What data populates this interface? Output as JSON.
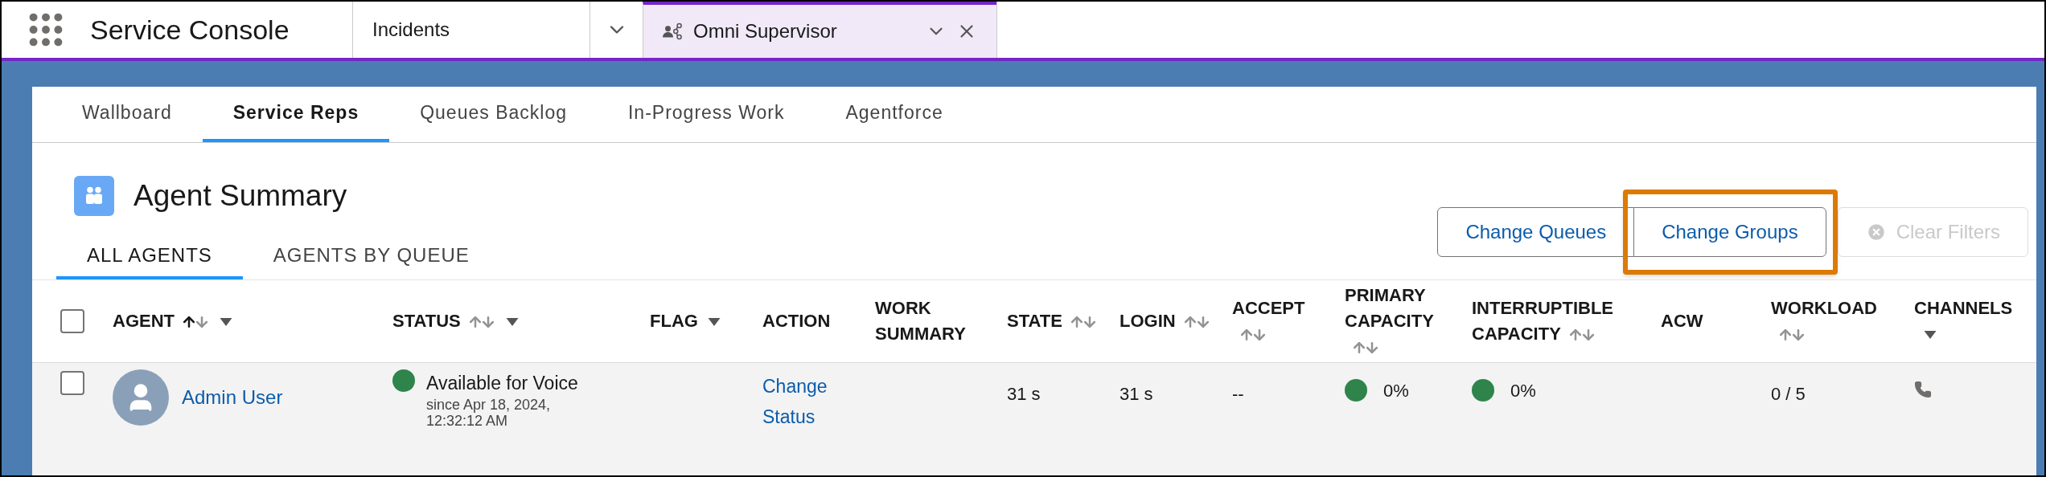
{
  "app": {
    "title": "Service Console"
  },
  "console_tabs": [
    {
      "label": "Incidents",
      "selected": false
    },
    {
      "label": "Omni Supervisor",
      "selected": true
    }
  ],
  "nav_tabs": [
    {
      "label": "Wallboard",
      "selected": false
    },
    {
      "label": "Service Reps",
      "selected": true
    },
    {
      "label": "Queues Backlog",
      "selected": false
    },
    {
      "label": "In-Progress Work",
      "selected": false
    },
    {
      "label": "Agentforce",
      "selected": false
    }
  ],
  "header": {
    "title": "Agent Summary"
  },
  "sub_tabs": [
    {
      "label": "ALL AGENTS",
      "selected": true
    },
    {
      "label": "AGENTS BY QUEUE",
      "selected": false
    }
  ],
  "buttons": [
    {
      "label": "Change Queues",
      "disabled": false,
      "highlighted": false
    },
    {
      "label": "Change Groups",
      "disabled": false,
      "highlighted": true
    },
    {
      "label": "Clear Filters",
      "disabled": true,
      "highlighted": false
    }
  ],
  "table": {
    "select_all_checked": false,
    "columns": [
      {
        "label": "AGENT",
        "sortable": true,
        "sorted_ascending": true,
        "filter": true
      },
      {
        "label": "STATUS",
        "sortable": true,
        "sorted_ascending": false,
        "filter": true
      },
      {
        "label": "FLAG",
        "sortable": false,
        "filter": true
      },
      {
        "label": "ACTION",
        "sortable": false,
        "filter": false
      },
      {
        "label": "WORK SUMMARY",
        "sortable": false,
        "filter": false
      },
      {
        "label": "STATE",
        "sortable": true,
        "sorted_ascending": false,
        "filter": false
      },
      {
        "label": "LOGIN",
        "sortable": true,
        "sorted_ascending": false,
        "filter": false
      },
      {
        "label": "ACCEPT",
        "sortable": true,
        "sorted_ascending": false,
        "filter": false
      },
      {
        "label": "PRIMARY CAPACITY",
        "sortable": true,
        "sorted_ascending": false,
        "filter": false
      },
      {
        "label": "INTERRUPTIBLE CAPACITY",
        "sortable": true,
        "sorted_ascending": false,
        "filter": false
      },
      {
        "label": "ACW",
        "sortable": false,
        "filter": false
      },
      {
        "label": "WORKLOAD",
        "sortable": true,
        "sorted_ascending": false,
        "filter": false
      },
      {
        "label": "CHANNELS",
        "sortable": false,
        "filter": true
      }
    ],
    "rows": [
      {
        "checked": false,
        "agent": "Admin User",
        "status": {
          "color": "#2e844a",
          "label": "Available for Voice",
          "since": "since  Apr 18, 2024, 12:32:12 AM"
        },
        "action": "Change Status",
        "state": "31 s",
        "login": "31 s",
        "accept": "--",
        "primary_capacity": {
          "color": "#2e844a",
          "value": "0%"
        },
        "interruptible_capacity": {
          "color": "#2e844a",
          "value": "0%"
        },
        "workload": "0 / 5",
        "channels": [
          {
            "kind": "phone"
          }
        ]
      }
    ]
  }
}
